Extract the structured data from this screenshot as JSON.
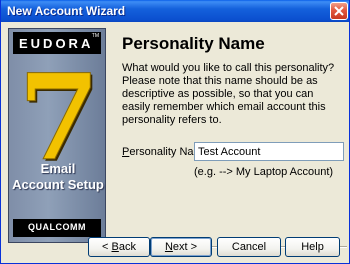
{
  "window": {
    "title": "New Account Wizard",
    "close_icon": "close-icon"
  },
  "banner": {
    "brand": "EUDORA",
    "trademark": "TM",
    "version": "7",
    "product_line1": "Email",
    "product_line2": "Account Setup",
    "vendor": "QUALCOMM"
  },
  "page": {
    "heading": "Personality Name",
    "description": "What would you like to call this personality? Please note that this name should be as descriptive as possible, so that you can easily remember which email account this personality refers to.",
    "field": {
      "label_prefix": "P",
      "label_rest": "ersonality Name:",
      "value": "Test Account",
      "hint": "(e.g. --> My Laptop Account)"
    }
  },
  "buttons": {
    "back_prefix": "< ",
    "back_key": "B",
    "back_rest": "ack",
    "next_key": "N",
    "next_rest": "ext >",
    "cancel": "Cancel",
    "help": "Help"
  },
  "colors": {
    "titlebar": "#0b4fcf",
    "dialog_bg": "#ece9d8",
    "banner_bg": "#6d7e9a",
    "seven_gold": "#f2c200"
  }
}
